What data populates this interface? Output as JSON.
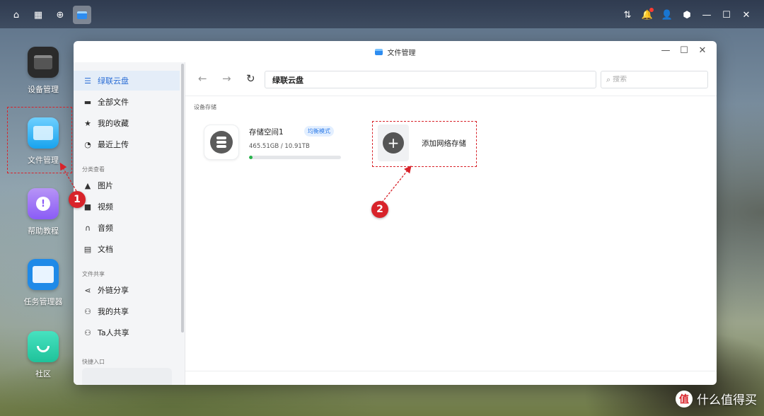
{
  "desktop": {
    "icons": [
      {
        "label": "设备管理"
      },
      {
        "label": "文件管理"
      },
      {
        "label": "帮助教程"
      },
      {
        "label": "任务管理器"
      },
      {
        "label": "社区"
      }
    ]
  },
  "window": {
    "title": "文件管理",
    "controls": {
      "minimize": "—",
      "maximize": "☐",
      "close": "✕"
    }
  },
  "sidebar": {
    "items": [
      {
        "label": "绿联云盘"
      },
      {
        "label": "全部文件"
      },
      {
        "label": "我的收藏"
      },
      {
        "label": "最近上传"
      }
    ],
    "category_title": "分类查看",
    "category_items": [
      {
        "label": "图片"
      },
      {
        "label": "视频"
      },
      {
        "label": "音频"
      },
      {
        "label": "文档"
      }
    ],
    "share_title": "文件共享",
    "share_items": [
      {
        "label": "外链分享"
      },
      {
        "label": "我的共享"
      },
      {
        "label": "Ta人共享"
      }
    ],
    "quick_title": "快捷入口"
  },
  "toolbar": {
    "path": "绿联云盘",
    "search_placeholder": "搜索"
  },
  "main": {
    "section_title": "设备存储",
    "storage": {
      "name": "存储空间1",
      "mode": "均衡模式",
      "size": "465.51GB / 10.91TB",
      "usage_fraction": 0.042
    },
    "add_storage_label": "添加网络存储"
  },
  "annotations": {
    "badge1": "1",
    "badge2": "2",
    "color": "#d8232a"
  },
  "watermark": {
    "logo": "值",
    "text": "什么值得买"
  },
  "colors": {
    "accent": "#2d6fd6",
    "progress": "#26b34a"
  }
}
